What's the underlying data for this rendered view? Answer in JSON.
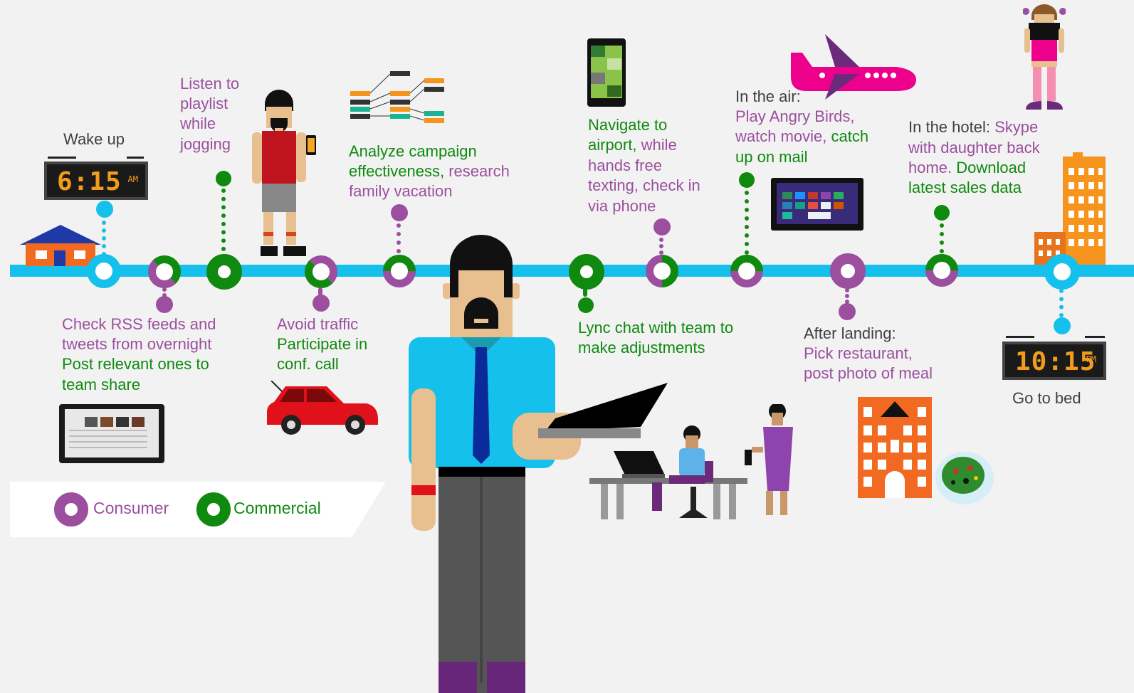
{
  "colors": {
    "consumer": "#9b4f9e",
    "commercial": "#0f8a0f",
    "timeline": "#16c0ec"
  },
  "wake": {
    "label": "Wake up",
    "time": "6:15",
    "ampm": "AM"
  },
  "bed": {
    "label": "Go to bed",
    "time": "10:15",
    "ampm": "PM"
  },
  "rss": {
    "line1": "Check RSS feeds and",
    "line2": "tweets from overnight",
    "line3": "Post relevant ones to",
    "line4": "team share"
  },
  "jog": {
    "line1": "Listen to",
    "line2": "playlist",
    "line3": "while",
    "line4": "jogging"
  },
  "traffic": {
    "line1": "Avoid traffic",
    "line2": "Participate in",
    "line3": "conf. call"
  },
  "analyze": {
    "line1": "Analyze campaign",
    "line2a": "effectiveness, ",
    "line2b": "research",
    "line3": "family vacation"
  },
  "navigate": {
    "line1": "Navigate to",
    "line2a": "airport, ",
    "line2b": "while",
    "line3": "hands free",
    "line4": "texting, check in",
    "line5": "via phone"
  },
  "lync": {
    "line1": "Lync chat with team to",
    "line2": "make adjustments"
  },
  "air": {
    "heading": "In the air:",
    "line1": "Play Angry Birds,",
    "line2a": "watch movie, ",
    "line2b": "catch",
    "line3": "up on mail"
  },
  "landing": {
    "heading": "After landing:",
    "line1": "Pick restaurant,",
    "line2": "post photo of meal"
  },
  "hotel": {
    "heading": "In the hotel: ",
    "line1a": "Skype",
    "line2": "with daughter back",
    "line3a": "home. ",
    "line3b": "Download",
    "line4": "latest sales data"
  },
  "legend": {
    "consumer": "Consumer",
    "commercial": "Commercial"
  },
  "tablet_icon": "windows-tablet-icon",
  "phone_icon": "windows-phone-icon",
  "plane_icon": "airplane-icon"
}
